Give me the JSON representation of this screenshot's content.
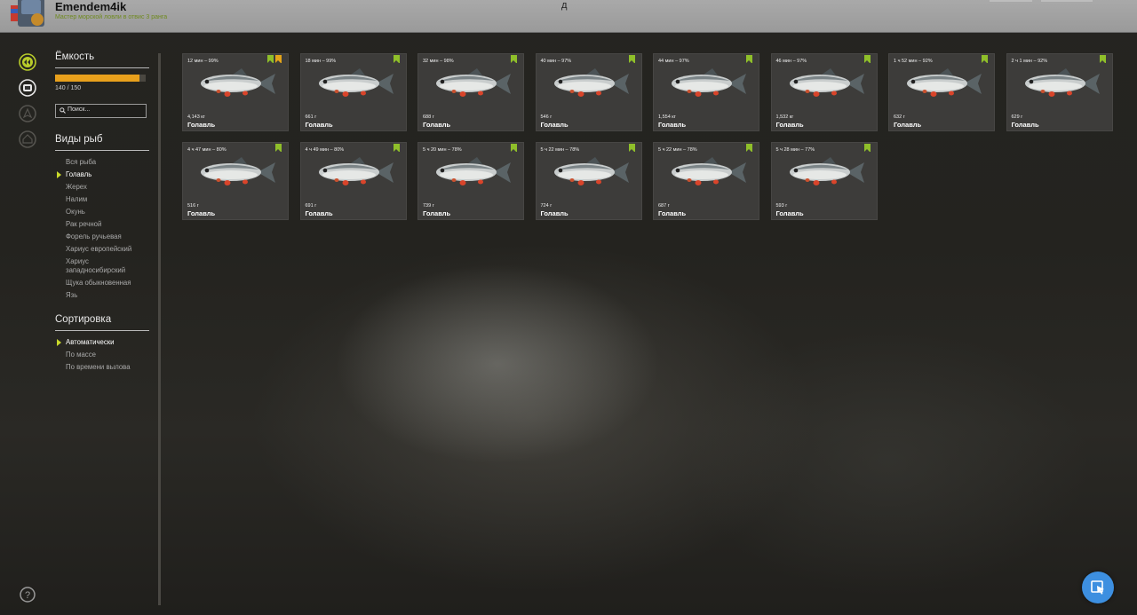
{
  "header": {
    "player_name": "Emendem4ik",
    "player_rank": "Мастер морской ловли в отвис 3 ранга",
    "center_mark": "д"
  },
  "sidebar": {
    "capacity": {
      "title": "Ёмкость",
      "value_text": "140 / 150",
      "fill_fraction": 0.933
    },
    "search": {
      "placeholder": "Поиск..."
    },
    "species": {
      "title": "Виды рыб",
      "items": [
        {
          "label": "Вся рыба",
          "active": false
        },
        {
          "label": "Голавль",
          "active": true
        },
        {
          "label": "Жерех",
          "active": false
        },
        {
          "label": "Налим",
          "active": false
        },
        {
          "label": "Окунь",
          "active": false
        },
        {
          "label": "Рак речной",
          "active": false
        },
        {
          "label": "Форель ручьевая",
          "active": false
        },
        {
          "label": "Хариус европейский",
          "active": false
        },
        {
          "label": "Хариус западносибирский",
          "active": false
        },
        {
          "label": "Щука обыкновенная",
          "active": false
        },
        {
          "label": "Язь",
          "active": false
        }
      ]
    },
    "sorting": {
      "title": "Сортировка",
      "items": [
        {
          "label": "Автоматически",
          "active": true
        },
        {
          "label": "По массе",
          "active": false
        },
        {
          "label": "По времени вылова",
          "active": false
        }
      ]
    }
  },
  "fish_cards": [
    {
      "time": "12 мин – 99%",
      "weight": "4,143 кг",
      "name": "Голавль",
      "gold_badge": true
    },
    {
      "time": "18 мин – 99%",
      "weight": "661 г",
      "name": "Голавль",
      "gold_badge": false
    },
    {
      "time": "32 мин – 98%",
      "weight": "688 г",
      "name": "Голавль",
      "gold_badge": false
    },
    {
      "time": "40 мин – 97%",
      "weight": "546 г",
      "name": "Голавль",
      "gold_badge": false
    },
    {
      "time": "44 мин – 97%",
      "weight": "1,554 кг",
      "name": "Голавль",
      "gold_badge": false
    },
    {
      "time": "46 мин – 97%",
      "weight": "1,532 кг",
      "name": "Голавль",
      "gold_badge": false
    },
    {
      "time": "1 ч 52 мин – 92%",
      "weight": "632 г",
      "name": "Голавль",
      "gold_badge": false
    },
    {
      "time": "2 ч 1 мин – 92%",
      "weight": "629 г",
      "name": "Голавль",
      "gold_badge": false
    },
    {
      "time": "4 ч 47 мин – 80%",
      "weight": "516 г",
      "name": "Голавль",
      "gold_badge": false
    },
    {
      "time": "4 ч 49 мин – 80%",
      "weight": "691 г",
      "name": "Голавль",
      "gold_badge": false
    },
    {
      "time": "5 ч 20 мин – 78%",
      "weight": "739 г",
      "name": "Голавль",
      "gold_badge": false
    },
    {
      "time": "5 ч 22 мин – 78%",
      "weight": "724 г",
      "name": "Голавль",
      "gold_badge": false
    },
    {
      "time": "5 ч 22 мин – 78%",
      "weight": "687 г",
      "name": "Голавль",
      "gold_badge": false
    },
    {
      "time": "5 ч 28 мин – 77%",
      "weight": "593 г",
      "name": "Голавль",
      "gold_badge": false
    }
  ],
  "icons": {
    "nav": [
      "back-arrows-icon",
      "fish-keepnet-icon",
      "map-icon",
      "home-icon"
    ],
    "help": "help-icon",
    "cursor": "cursor-icon"
  },
  "colors": {
    "accent_green": "#8fbf2a",
    "accent_gold": "#e4a419",
    "capacity_fill": "#e8a01c",
    "cursor_button": "#3d8fe0"
  }
}
